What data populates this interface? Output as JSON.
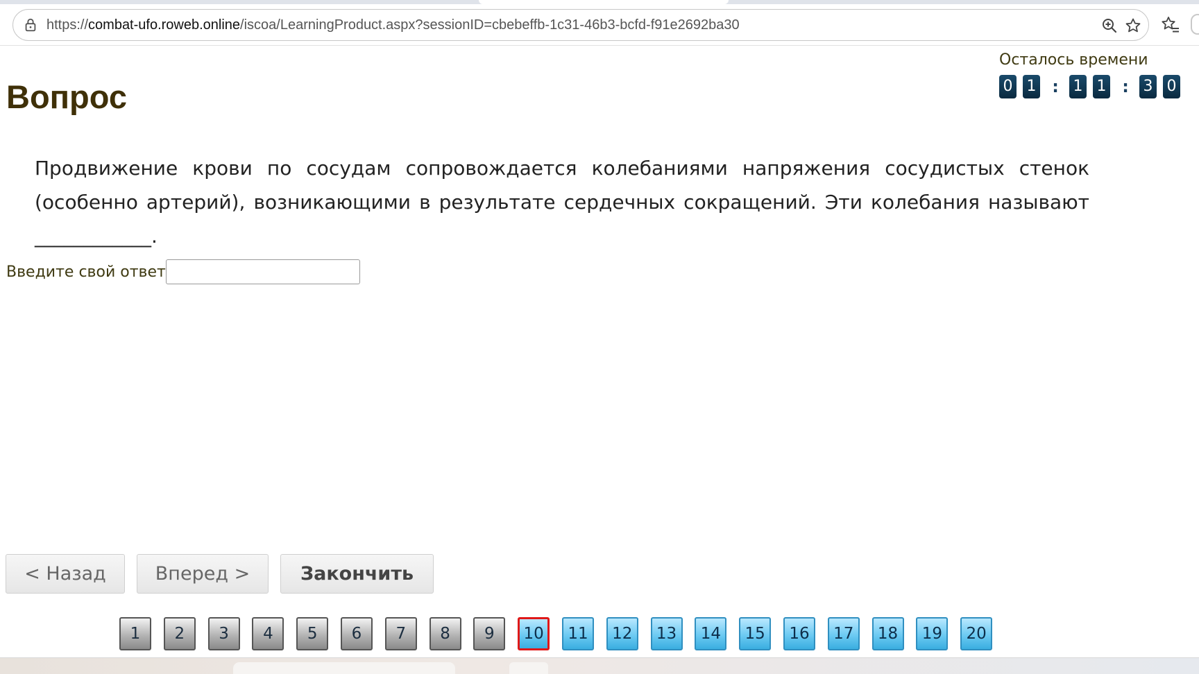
{
  "browser": {
    "url_prefix": "https://",
    "url_host": "combat-ufo.roweb.online",
    "url_path": "/iscoa/LearningProduct.aspx?sessionID=cbebeffb-1c31-46b3-bcfd-f91e2692ba30"
  },
  "page": {
    "heading": "Вопрос",
    "timer": {
      "label": "Осталось времени",
      "digits": [
        "0",
        "1",
        ":",
        "1",
        "1",
        ":",
        "3",
        "0"
      ]
    },
    "question": {
      "text": "Продвижение крови по сосудам сопровождается колебаниями напряжения сосудистых стенок (особенно артерий), возникающими в результате сердечных сокращений. Эти колебания называют ____________."
    },
    "answer": {
      "label": "Введите свой ответ",
      "value": ""
    },
    "nav": {
      "back": "< Назад",
      "forward": "Вперед >",
      "finish": "Закончить"
    },
    "pager": {
      "current": 10,
      "pages": [
        "1",
        "2",
        "3",
        "4",
        "5",
        "6",
        "7",
        "8",
        "9",
        "10",
        "11",
        "12",
        "13",
        "14",
        "15",
        "16",
        "17",
        "18",
        "19",
        "20"
      ]
    }
  },
  "colors": {
    "heading": "#3f3008",
    "timer_digit_bg": "#0a2a40",
    "current_page_border": "#e01818",
    "answered_page_fill": "#b4b4b4",
    "unanswered_page_fill": "#6ccaf2"
  },
  "icons": [
    "lock-icon",
    "zoom-icon",
    "star-icon",
    "favorites-icon"
  ]
}
